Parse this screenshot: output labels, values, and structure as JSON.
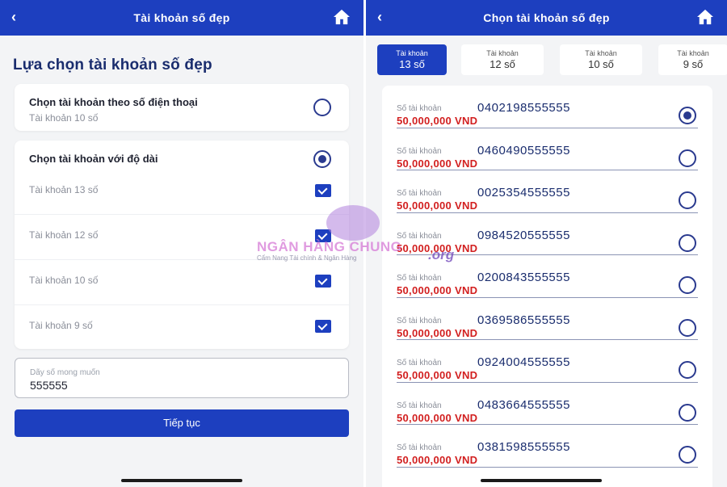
{
  "left": {
    "title": "Tài khoản số đẹp",
    "heading": "Lựa chọn tài khoản số đẹp",
    "phone_option": {
      "title": "Chọn tài khoản theo số điện thoại",
      "sub": "Tài khoản 10 số"
    },
    "length_option": {
      "title": "Chọn tài khoản với độ dài",
      "items": [
        {
          "label": "Tài khoản 13 số"
        },
        {
          "label": "Tài khoản 12 số"
        },
        {
          "label": "Tài khoản 10 số"
        },
        {
          "label": "Tài khoản 9 số"
        }
      ]
    },
    "search": {
      "placeholder": "Dãy số mong muốn",
      "value": "555555"
    },
    "next_button": "Tiếp tục"
  },
  "right": {
    "title": "Chọn tài khoản số đẹp",
    "tabs": [
      {
        "line1": "Tài khoản",
        "line2": "13 số",
        "active": true
      },
      {
        "line1": "Tài khoản",
        "line2": "12 số"
      },
      {
        "line1": "Tài khoản",
        "line2": "10 số"
      },
      {
        "line1": "Tài khoản",
        "line2": "9 số"
      }
    ],
    "account_caption": "Số tài khoản",
    "accounts": [
      {
        "number": "0402198555555",
        "price": "50,000,000 VND",
        "selected": true
      },
      {
        "number": "0460490555555",
        "price": "50,000,000 VND"
      },
      {
        "number": "0025354555555",
        "price": "50,000,000 VND"
      },
      {
        "number": "0984520555555",
        "price": "50,000,000 VND"
      },
      {
        "number": "0200843555555",
        "price": "50,000,000 VND"
      },
      {
        "number": "0369586555555",
        "price": "50,000,000 VND"
      },
      {
        "number": "0924004555555",
        "price": "50,000,000 VND"
      },
      {
        "number": "0483664555555",
        "price": "50,000,000 VND"
      },
      {
        "number": "0381598555555",
        "price": "50,000,000 VND"
      }
    ]
  },
  "watermark": {
    "brand": "NGÂN HÀNG CHUNG",
    "org": ".org",
    "tagline": "Cẩm Nang Tài chính & Ngân Hàng"
  },
  "colors": {
    "primary": "#1d3fbf",
    "heading": "#1a2d6e",
    "price": "#d21f1f"
  },
  "icons": {
    "back": "chevron-left-icon",
    "home": "home-icon"
  }
}
